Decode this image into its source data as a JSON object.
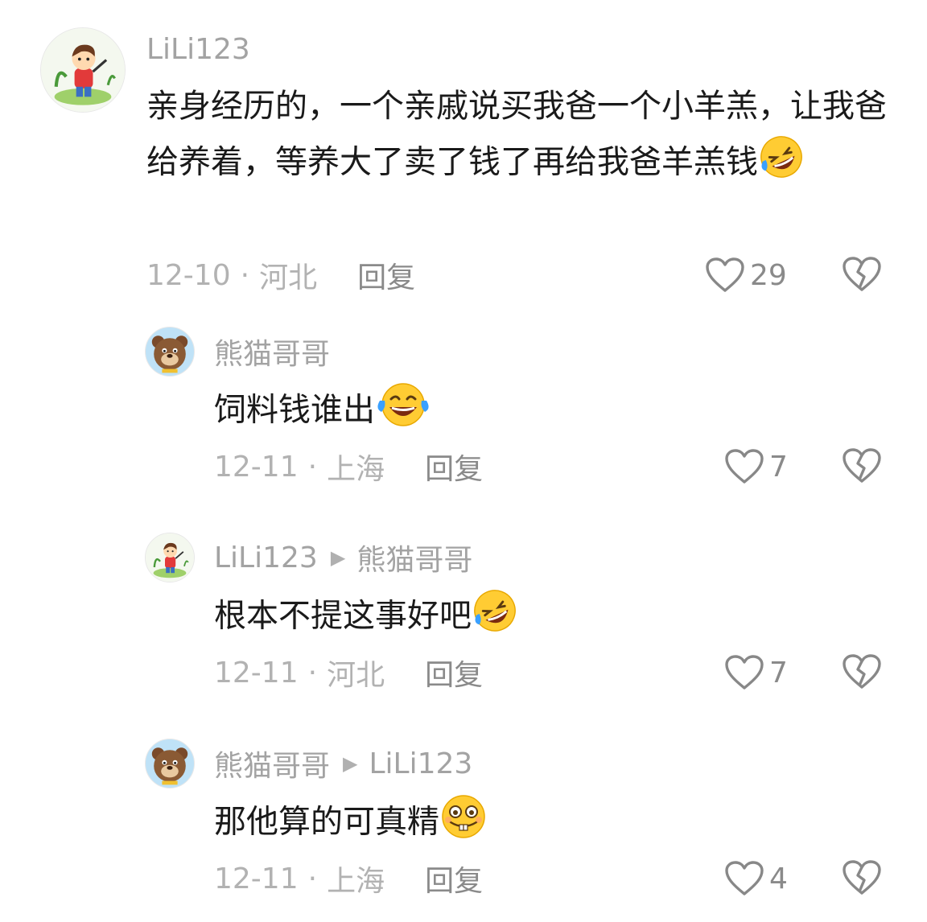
{
  "comments": [
    {
      "username": "LiLi123",
      "reply_to": "",
      "text": "亲身经历的，一个亲戚说买我爸一个小羊羔，让我爸给养着，等养大了卖了钱了再给我爸羊羔钱",
      "emoji": "rolling-laughing-emoji",
      "date": "12-10",
      "location": "河北",
      "reply_label": "回复",
      "likes": "29"
    },
    {
      "username": "熊猫哥哥",
      "reply_to": "",
      "text": "饲料钱谁出",
      "emoji": "tears-of-joy-emoji",
      "date": "12-11",
      "location": "上海",
      "reply_label": "回复",
      "likes": "7"
    },
    {
      "username": "LiLi123",
      "reply_to": "熊猫哥哥",
      "text": "根本不提这事好吧",
      "emoji": "rolling-laughing-emoji",
      "date": "12-11",
      "location": "河北",
      "reply_label": "回复",
      "likes": "7"
    },
    {
      "username": "熊猫哥哥",
      "reply_to": "LiLi123",
      "text": "那他算的可真精",
      "emoji": "buck-teeth-grin-emoji",
      "date": "12-11",
      "location": "上海",
      "reply_label": "回复",
      "likes": "4"
    }
  ],
  "meta_separator": "·",
  "reply_arrow": "▶",
  "icons": {
    "like": "heart-outline-icon",
    "dislike": "broken-heart-icon",
    "avatar_lili": "boy-cartoon-avatar",
    "avatar_panda": "bear-cartoon-avatar"
  },
  "colors": {
    "username": "#a3a3a3",
    "meta": "#b2b2b2",
    "action": "#8a8a8a",
    "emoji_yellow": "#ffcc33"
  }
}
